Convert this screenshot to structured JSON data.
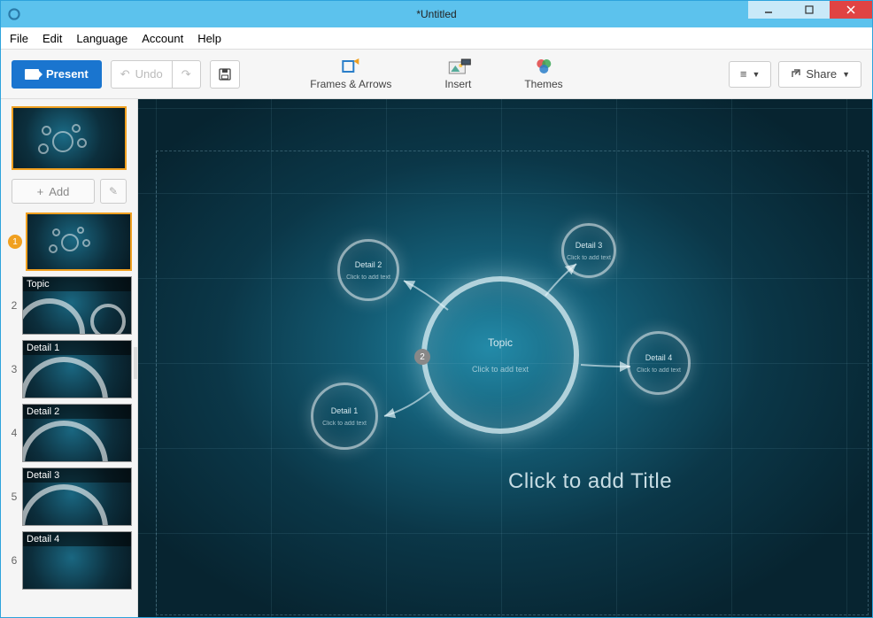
{
  "window": {
    "title": "*Untitled"
  },
  "menu": {
    "file": "File",
    "edit": "Edit",
    "language": "Language",
    "account": "Account",
    "help": "Help"
  },
  "toolbar": {
    "present": "Present",
    "undo": "Undo",
    "frames": "Frames & Arrows",
    "insert": "Insert",
    "themes": "Themes",
    "share": "Share"
  },
  "sidebar": {
    "add": "Add",
    "slides": [
      {
        "num": "1",
        "label": ""
      },
      {
        "num": "2",
        "label": "Topic"
      },
      {
        "num": "3",
        "label": "Detail 1"
      },
      {
        "num": "4",
        "label": "Detail 2"
      },
      {
        "num": "5",
        "label": "Detail 3"
      },
      {
        "num": "6",
        "label": "Detail 4"
      }
    ]
  },
  "canvas": {
    "mainTopic": "Topic",
    "mainSub": "Click to add text",
    "detail1": "Detail 1",
    "detail1sub": "Click to add text",
    "detail2": "Detail 2",
    "detail2sub": "Click to add text",
    "detail3": "Detail 3",
    "detail3sub": "Click to add text",
    "detail4": "Detail 4",
    "detail4sub": "Click to add text",
    "badge": "2",
    "titlePlaceholder": "Click to add Title"
  }
}
